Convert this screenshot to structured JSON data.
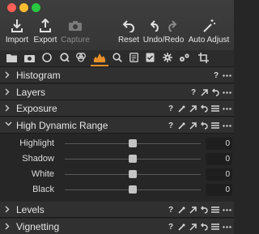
{
  "toolbar": {
    "import": "Import",
    "export": "Export",
    "capture": "Capture",
    "reset": "Reset",
    "undo_redo": "Undo/Redo",
    "auto_adjust": "Auto Adjust"
  },
  "tabs": [
    "folder",
    "camera",
    "lens",
    "color",
    "exposure",
    "details",
    "metadata",
    "adjust",
    "badge",
    "settings",
    "batch",
    "crop"
  ],
  "active_tab": 4,
  "panels": {
    "histogram": {
      "title": "Histogram",
      "help": "?"
    },
    "layers": {
      "title": "Layers",
      "help": "?"
    },
    "exposure": {
      "title": "Exposure",
      "help": "?"
    },
    "hdr": {
      "title": "High Dynamic Range",
      "help": "?",
      "sliders": [
        {
          "label": "Highlight",
          "value": "0",
          "position": 0.5
        },
        {
          "label": "Shadow",
          "value": "0",
          "position": 0.5
        },
        {
          "label": "White",
          "value": "0",
          "position": 0.5
        },
        {
          "label": "Black",
          "value": "0",
          "position": 0.5
        }
      ]
    },
    "levels": {
      "title": "Levels",
      "help": "?"
    },
    "vignetting": {
      "title": "Vignetting",
      "help": "?"
    }
  },
  "colors": {
    "accent": "#e8902a",
    "background": "#262626",
    "header": "#303030"
  }
}
